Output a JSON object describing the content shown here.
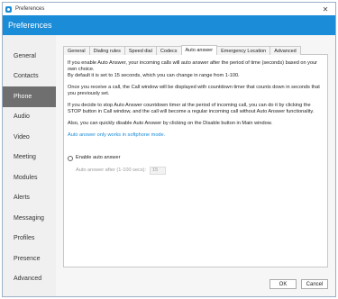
{
  "window": {
    "title": "Preferences",
    "close_glyph": "✕"
  },
  "header": {
    "title": "Preferences"
  },
  "sidebar": {
    "items": [
      {
        "label": "General"
      },
      {
        "label": "Contacts"
      },
      {
        "label": "Phone"
      },
      {
        "label": "Audio"
      },
      {
        "label": "Video"
      },
      {
        "label": "Meeting"
      },
      {
        "label": "Modules"
      },
      {
        "label": "Alerts"
      },
      {
        "label": "Messaging"
      },
      {
        "label": "Profiles"
      },
      {
        "label": "Presence"
      },
      {
        "label": "Advanced"
      }
    ],
    "active": "Phone"
  },
  "tabs": [
    {
      "label": "General"
    },
    {
      "label": "Dialing rules"
    },
    {
      "label": "Speed dial"
    },
    {
      "label": "Codecs"
    },
    {
      "label": "Auto answer"
    },
    {
      "label": "Emergency Location"
    },
    {
      "label": "Advanced"
    }
  ],
  "active_tab": "Auto answer",
  "auto_answer": {
    "para1": "If you enable Auto Answer, your incoming calls will auto answer after the period of time (seconds) based on your own choice.",
    "para1b": "By default it is set to 15 seconds, which you can change in range from 1-100.",
    "para2": "Once you receive a call, the Call window will be displayed with countdown timer that counts down in seconds that you previously set.",
    "para3": "If you decide to stop Auto Answer countdown timer at the period of incoming call, you can do it by clicking the STOP button in Call window, and the call will become a regular incoming call without Auto Answer functionality.",
    "para4": "Also, you can quickly disable Auto Answer by clicking on the Disable button in Main window.",
    "note": "Auto answer only works in softphone mode.",
    "enable_label": "Enable auto answer",
    "delay_label": "Auto answer after (1-100 secs):",
    "delay_value": "15"
  },
  "footer": {
    "ok": "OK",
    "cancel": "Cancel"
  },
  "colors": {
    "accent": "#1a8cd8",
    "sidebar_active": "#6f6f6f"
  }
}
